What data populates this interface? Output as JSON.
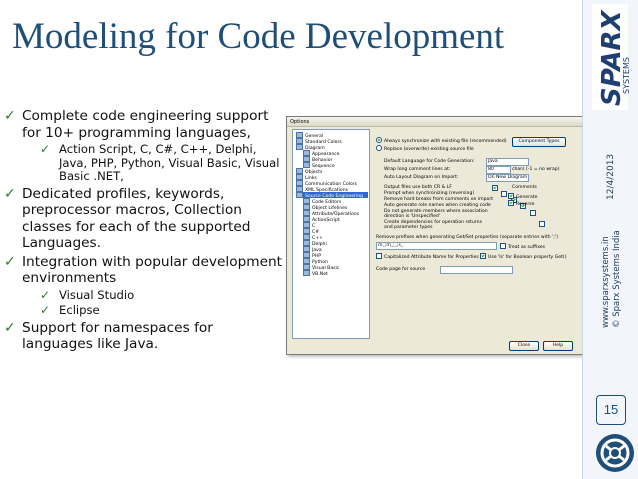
{
  "slide": {
    "title": "Modeling for Code Development",
    "bullets": [
      {
        "text": "Complete code engineering support for 10+ programming languages,",
        "sub": [
          "Action Script, C, C#, C++, Delphi, Java, PHP, Python, Visual Basic, Visual Basic .NET,"
        ]
      },
      {
        "text": "Dedicated profiles, keywords, preprocessor macros, Collection classes for each of the supported Languages.",
        "sub": []
      },
      {
        "text": "Integration with popular development environments",
        "sub": [
          "Visual Studio",
          "Eclipse"
        ]
      },
      {
        "text": "Support for namespaces for languages like Java.",
        "sub": []
      }
    ],
    "check_glyph": "✓",
    "date": "12/4/2013",
    "website": "www.sparxsystems.in",
    "copyright": "© Sparx Systems India",
    "page_number": "15",
    "logo": {
      "main": "SPARX",
      "sub": "SYSTEMS"
    }
  },
  "dialog": {
    "title": "Options",
    "tree": [
      {
        "label": "General",
        "indent": 1
      },
      {
        "label": "Standard Colors",
        "indent": 1
      },
      {
        "label": "Diagram",
        "indent": 1
      },
      {
        "label": "Appearance",
        "indent": 2
      },
      {
        "label": "Behavior",
        "indent": 2
      },
      {
        "label": "Sequence",
        "indent": 2
      },
      {
        "label": "Objects",
        "indent": 1
      },
      {
        "label": "Links",
        "indent": 1
      },
      {
        "label": "Communication Colors",
        "indent": 1
      },
      {
        "label": "XML Specifications",
        "indent": 1
      },
      {
        "label": "Source Code Engineering",
        "indent": 1,
        "selected": true
      },
      {
        "label": "Code Editors",
        "indent": 2
      },
      {
        "label": "Object Lifelines",
        "indent": 2
      },
      {
        "label": "Attribute/Operations",
        "indent": 2
      },
      {
        "label": "ActionScript",
        "indent": 2
      },
      {
        "label": "C",
        "indent": 2
      },
      {
        "label": "C#",
        "indent": 2
      },
      {
        "label": "C++",
        "indent": 2
      },
      {
        "label": "Delphi",
        "indent": 2
      },
      {
        "label": "Java",
        "indent": 2
      },
      {
        "label": "PHP",
        "indent": 2
      },
      {
        "label": "Python",
        "indent": 2
      },
      {
        "label": "Visual Basic",
        "indent": 2
      },
      {
        "label": "VB.Net",
        "indent": 2
      }
    ],
    "radio1": "Always synchronize with existing file (recommended)",
    "radio2": "Replace (overwrite) existing source file",
    "component_types_btn": "Component Types",
    "default_language_label": "Default Language for Code Generation:",
    "default_language_value": "Java",
    "wrap_label": "Wrap long comment lines at:",
    "wrap_value": "80",
    "wrap_unit": "chars (-1 = no wrap)",
    "auto_layout_label": "Auto Layout Diagram on Import:",
    "auto_layout_value": "On New Diagram",
    "opts": [
      {
        "label": "Output files use both CR & LF",
        "checked": true
      },
      {
        "label": "Prompt when synchronizing (reversing)",
        "checked": false
      },
      {
        "label": "Remove hard breaks from comments on import",
        "checked": true
      },
      {
        "label": "Auto generate role names when creating code",
        "checked": true
      },
      {
        "label": "Do not generate members where association direction is 'Unspecified'",
        "checked": false
      },
      {
        "label": "Create dependencies for operation returns and parameter types",
        "checked": false
      }
    ],
    "comments_label": "Comments",
    "comments_generate": "Generate",
    "comments_reverse": "Reverse",
    "prefix_label": "Remove prefixes when generating Get/Set properties",
    "prefix_hint": "(separate entries with ';')",
    "prefix_value": "m_;m_;_;s_",
    "treat_suffix": "Treat as suffixes",
    "capitalized": "Capitalized Attribute Name for Properties",
    "use_is": "Use 'Is' for Boolean property Get()",
    "code_page_label": "Code page for source",
    "close_btn": "Close",
    "help_btn": "Help"
  }
}
